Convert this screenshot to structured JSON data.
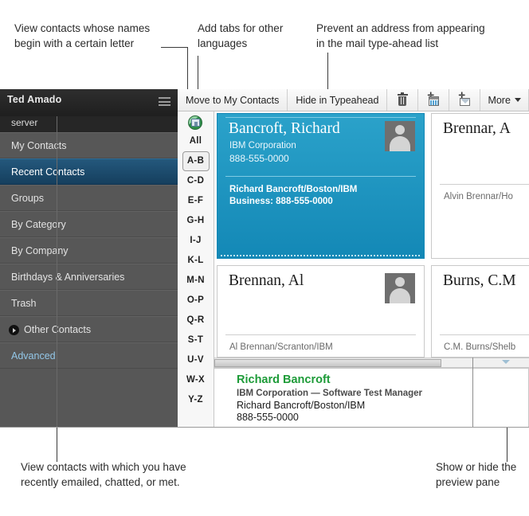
{
  "annotations": [
    {
      "name": "letter-index-callout",
      "lines": [
        "View contacts whose names",
        "begin with a certain letter"
      ]
    },
    {
      "name": "language-tabs-callout",
      "lines": [
        "Add tabs for other",
        "languages"
      ]
    },
    {
      "name": "typeahead-callout",
      "lines": [
        "Prevent an address from appearing",
        "in the mail type-ahead list"
      ]
    },
    {
      "name": "recent-contacts-callout",
      "lines": [
        "View contacts with which you have",
        "recently emailed, chatted, or met."
      ]
    },
    {
      "name": "preview-pane-callout",
      "lines": [
        "Show or hide the",
        "preview pane"
      ]
    }
  ],
  "sidebar": {
    "user": "Ted Amado",
    "server": "server",
    "menu_icon": "hamburger-menu-icon",
    "items": [
      {
        "label": "My Contacts",
        "state": "normal",
        "expander": false
      },
      {
        "label": "Recent Contacts",
        "state": "selected",
        "expander": false
      },
      {
        "label": "Groups",
        "state": "normal",
        "expander": false
      },
      {
        "label": "By Category",
        "state": "normal",
        "expander": false
      },
      {
        "label": "By Company",
        "state": "normal",
        "expander": false
      },
      {
        "label": "Birthdays & Anniversaries",
        "state": "normal",
        "expander": false
      },
      {
        "label": "Trash",
        "state": "normal",
        "expander": false
      },
      {
        "label": "Other Contacts",
        "state": "normal",
        "expander": true
      },
      {
        "label": "Advanced",
        "state": "link",
        "expander": false
      }
    ]
  },
  "toolbar": {
    "move_to_my_contacts": "Move to My Contacts",
    "hide_in_typeahead": "Hide in Typeahead",
    "delete_icon": "trash-icon",
    "add_to_calendar_icon": "calendar-add-icon",
    "new_message_icon": "mail-add-icon",
    "more_label": "More",
    "more_caret": "chevron-down-icon"
  },
  "letter_index": {
    "language_icon": "globe-language-icon",
    "selected": "A-B",
    "letters": [
      "All",
      "A-B",
      "C-D",
      "E-F",
      "G-H",
      "I-J",
      "K-L",
      "M-N",
      "O-P",
      "Q-R",
      "S-T",
      "U-V",
      "W-X",
      "Y-Z"
    ]
  },
  "cards": [
    {
      "name": "Bancroft, Richard",
      "company": "IBM Corporation",
      "phone": "888-555-0000",
      "footer": "Richard Bancroft/Boston/IBM",
      "footer2": "Business:  888-555-0000",
      "selected": true,
      "avatar": "person-placeholder-avatar"
    },
    {
      "name": "Brennar, A",
      "company": "",
      "phone": "",
      "footer": "Alvin Brennar/Ho",
      "footer2": "",
      "selected": false,
      "avatar": ""
    },
    {
      "name": "Brennan, Al",
      "company": "",
      "phone": "",
      "footer": "Al Brennan/Scranton/IBM",
      "footer2": "",
      "selected": false,
      "avatar": "person-placeholder-avatar"
    },
    {
      "name": "Burns, C.M",
      "company": "",
      "phone": "",
      "footer": "C.M. Burns/Shelb",
      "footer2": "",
      "selected": false,
      "avatar": ""
    }
  ],
  "preview": {
    "name": "Richard Bancroft",
    "role": "IBM Corporation  —  Software Test Manager",
    "address": "Richard Bancroft/Boston/IBM",
    "phone": "888-555-0000"
  },
  "colors": {
    "selected_card": "#1b9bc9",
    "selected_nav": "#1d4f72",
    "preview_name_green": "#1d9b38",
    "sidebar_bg": "#575757",
    "sidebar_header_bg": "#262626",
    "link_blue": "#93c7e8"
  }
}
